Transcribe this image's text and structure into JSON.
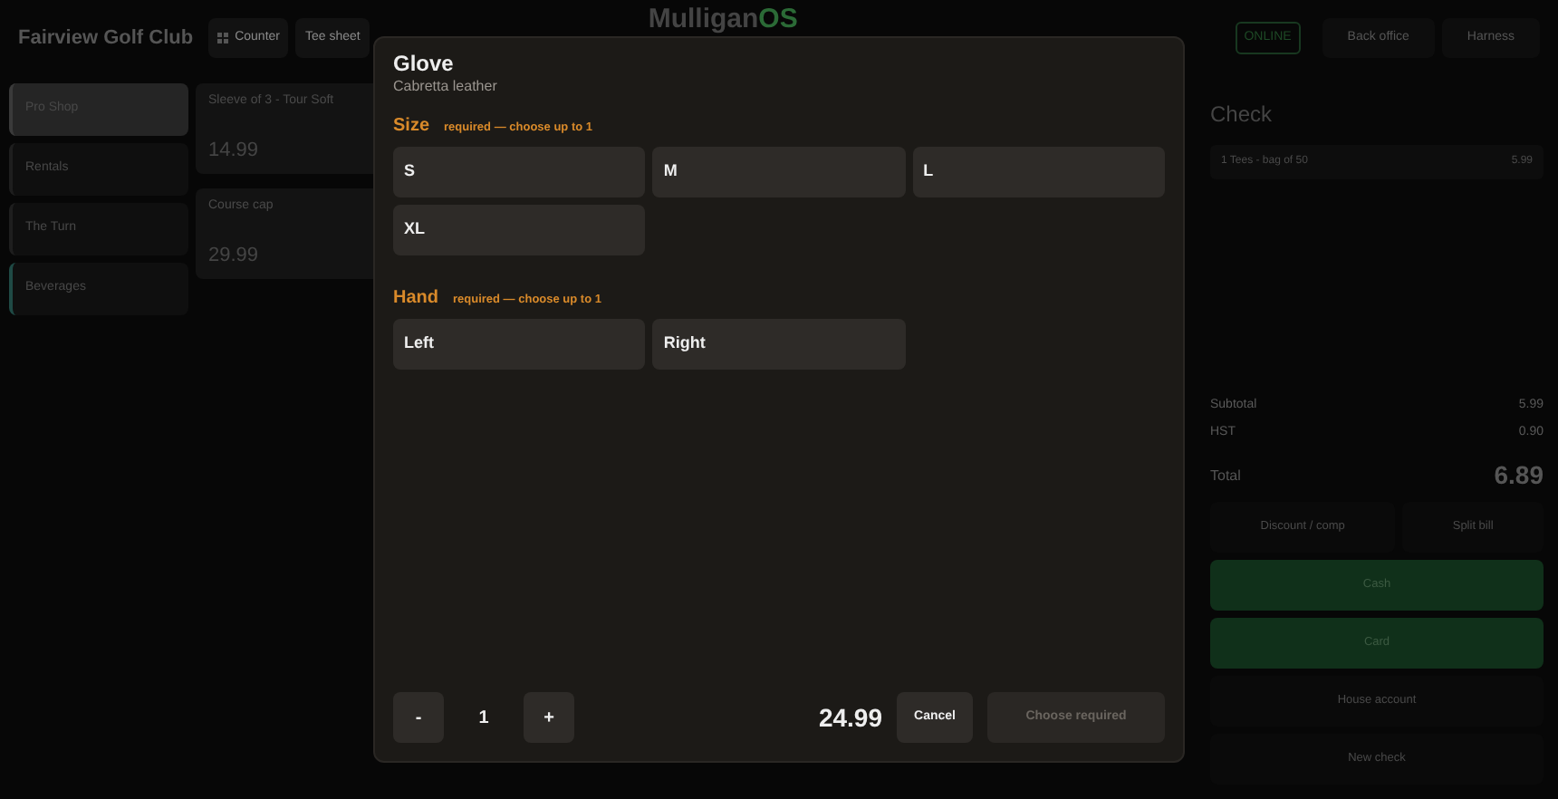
{
  "header": {
    "club": "Fairview Golf Club",
    "nav": [
      {
        "label": "Counter"
      },
      {
        "label": "Tee sheet"
      }
    ],
    "logo": {
      "main": "Mulligan",
      "accent": "OS"
    },
    "status": "ONLINE",
    "actions": [
      "Back office",
      "Harness"
    ]
  },
  "categories": [
    {
      "label": "Pro Shop",
      "selected": true,
      "color": "#3a3a3a"
    },
    {
      "label": "Rentals",
      "selected": false,
      "color": "#1e1e1e"
    },
    {
      "label": "The Turn",
      "selected": false,
      "color": "#1e1e1e"
    },
    {
      "label": "Beverages",
      "selected": false,
      "color": "#1f4a45"
    }
  ],
  "products": [
    {
      "name": "Sleeve of 3 - Tour Soft",
      "price": "14.99"
    },
    {
      "name": "Course cap",
      "price": "29.99"
    }
  ],
  "check": {
    "title": "Check",
    "lines": [
      {
        "text": "1 Tees - bag of 50",
        "amount": "5.99"
      }
    ],
    "totals": [
      {
        "label": "Subtotal",
        "amount": "5.99"
      },
      {
        "label": "HST",
        "amount": "0.90"
      }
    ],
    "total": {
      "label": "Total",
      "amount": "6.89"
    },
    "buttons": [
      {
        "label": "Discount / comp",
        "kind": "plain"
      },
      {
        "label": "Split bill",
        "kind": "plain"
      },
      {
        "label": "Cash",
        "kind": "pay"
      },
      {
        "label": "Card",
        "kind": "pay"
      },
      {
        "label": "House account",
        "kind": "wide"
      },
      {
        "label": "New check",
        "kind": "wide"
      }
    ]
  },
  "modal": {
    "title": "Glove",
    "subtitle": "Cabretta leather",
    "groups": [
      {
        "name": "Size",
        "rule": "required — choose up to 1",
        "options": [
          {
            "label": "S",
            "selected": false
          },
          {
            "label": "M",
            "selected": false
          },
          {
            "label": "L",
            "selected": false
          },
          {
            "label": "XL",
            "selected": false
          }
        ]
      },
      {
        "name": "Hand",
        "rule": "required — choose up to 1",
        "options": [
          {
            "label": "Left",
            "selected": false
          },
          {
            "label": "Right",
            "selected": false
          }
        ]
      }
    ],
    "minus": "-",
    "quantity": "1",
    "plus": "+",
    "price": "24.99",
    "cancel": "Cancel",
    "confirm": {
      "label": "Choose required",
      "disabled": true
    }
  }
}
